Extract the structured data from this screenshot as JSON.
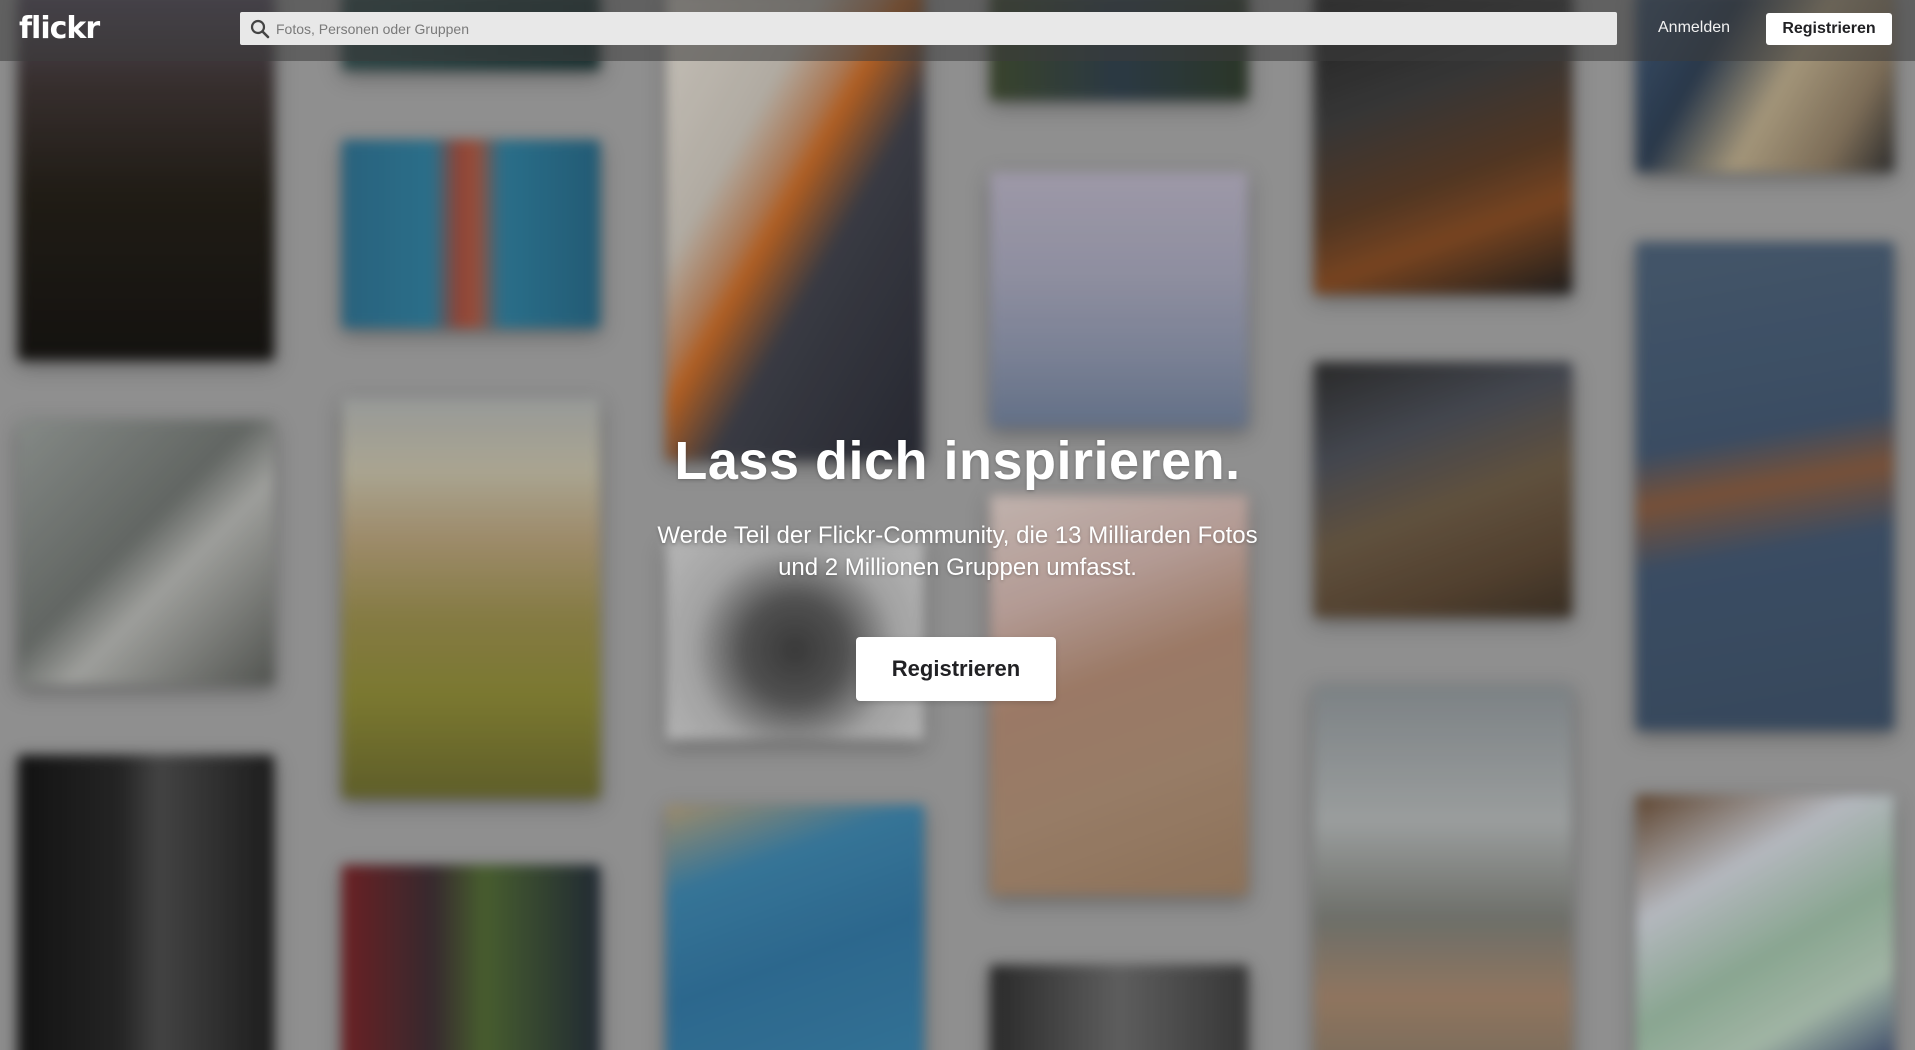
{
  "header": {
    "logo": "flickr",
    "search_placeholder": "Fotos, Personen oder Gruppen",
    "login_label": "Anmelden",
    "register_label": "Registrieren"
  },
  "hero": {
    "title": "Lass dich inspirieren.",
    "subtitle": "Werde Teil der Flickr-Community, die 13 Milliarden Fotos und 2 Millionen Gruppen umfasst.",
    "cta_label": "Registrieren"
  },
  "colors": {
    "topbar": "#3c3c3c",
    "button_bg": "#ffffff",
    "button_text": "#212124",
    "hero_text": "#ffffff"
  }
}
